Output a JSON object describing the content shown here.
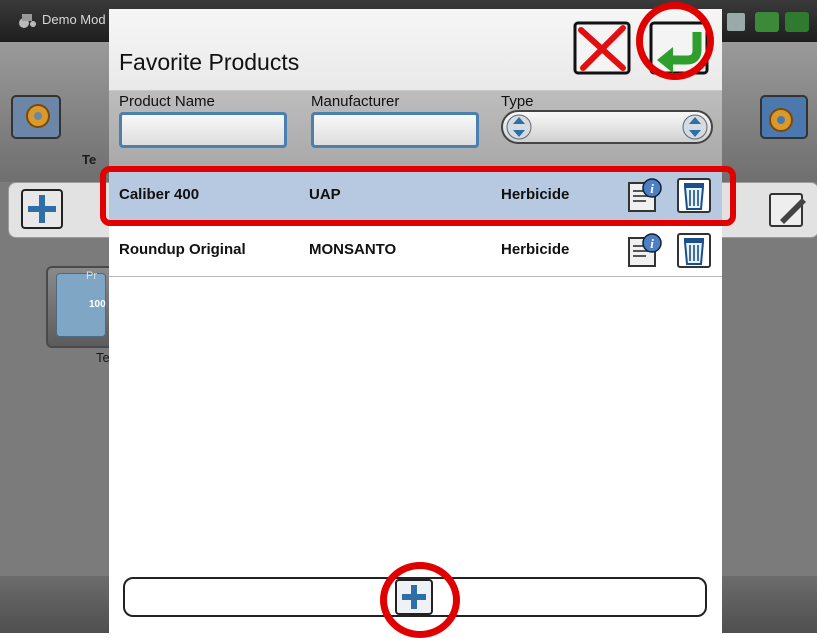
{
  "background": {
    "app_title": "Demo Mod",
    "tile_label": "Te",
    "product_tile_prefix": "Pr",
    "product_tile_value": "100",
    "product_tile_label": "Te"
  },
  "dialog": {
    "title": "Favorite Products",
    "cancel_icon": "red-x-icon",
    "ok_icon": "green-return-arrow-icon",
    "filters": {
      "product_name_label": "Product Name",
      "product_name_value": "",
      "manufacturer_label": "Manufacturer",
      "manufacturer_value": "",
      "type_label": "Type",
      "type_value": ""
    },
    "rows": [
      {
        "product": "Caliber 400",
        "manufacturer": "UAP",
        "type": "Herbicide",
        "selected": true
      },
      {
        "product": "Roundup Original",
        "manufacturer": "MONSANTO",
        "type": "Herbicide",
        "selected": false
      }
    ],
    "add_icon": "plus-icon"
  },
  "colors": {
    "highlight": "#e00000",
    "selected_row": "#b7c9e0",
    "accent_blue": "#4a7fae"
  }
}
